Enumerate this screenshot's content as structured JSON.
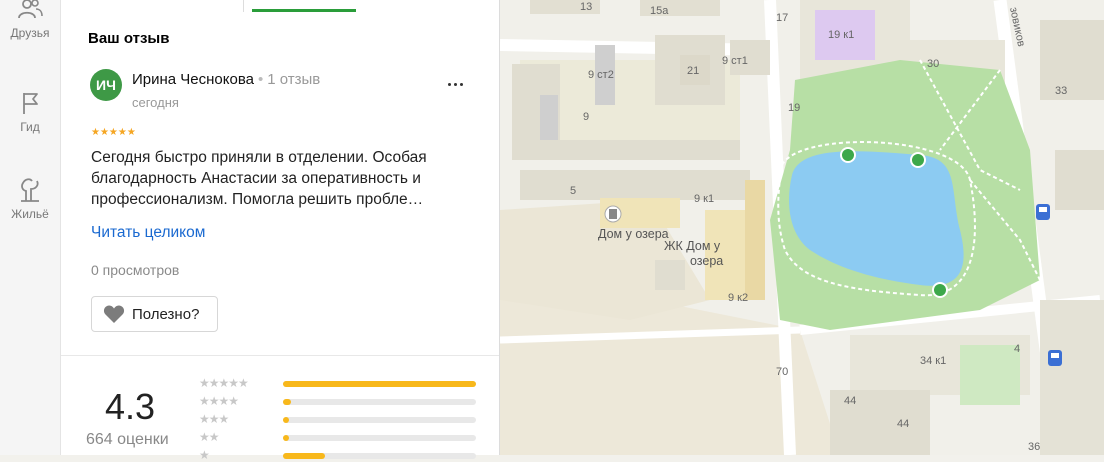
{
  "nav": {
    "items": [
      {
        "label": "Друзья",
        "icon": "friends-icon"
      },
      {
        "label": "Гид",
        "icon": "flag-icon"
      },
      {
        "label": "Жильё",
        "icon": "housing-icon"
      }
    ]
  },
  "review": {
    "section_title": "Ваш отзыв",
    "avatar_initials": "ИЧ",
    "author": "Ирина Чеснокова",
    "author_reviews": "1 отзыв",
    "date": "сегодня",
    "rating": 5,
    "stars": "★★★★★",
    "text": "Сегодня быстро приняли в отделении. Особая благодарность Анастасии за оперативность и профессионализм. Помогла решить пробле…",
    "read_more": "Читать целиком",
    "views": "0 просмотров",
    "useful_label": "Полезно?"
  },
  "summary": {
    "rating": "4.3",
    "count": "664 оценки",
    "distribution": [
      {
        "stars": "★★★★★",
        "fraction": 1.0
      },
      {
        "stars": "★★★★",
        "fraction": 0.04
      },
      {
        "stars": "★★★",
        "fraction": 0.03
      },
      {
        "stars": "★★",
        "fraction": 0.03
      },
      {
        "stars": "★",
        "fraction": 0.22
      }
    ]
  },
  "map": {
    "labels": {
      "b13": "13",
      "b15a": "15а",
      "b17": "17",
      "b19k1": "19 к1",
      "street": "зовиков",
      "b9st2": "9 ст2",
      "b21": "21",
      "b9st1": "9 ст1",
      "b30": "30",
      "b33": "33",
      "b9": "9",
      "b19": "19",
      "b5": "5",
      "b9k1": "9 к1",
      "b9k2": "9 к2",
      "b70": "70",
      "b34k1": "34 к1",
      "b4": "4",
      "b44a": "44",
      "b44b": "44",
      "b36": "36"
    },
    "pois": {
      "house_by_lake": "Дом у озера",
      "complex_line1": "ЖК Дом у",
      "complex_line2": "озера"
    }
  },
  "colors": {
    "accent_green": "#2a9d3a",
    "link": "#1a69d0",
    "star": "#f5a623",
    "bar": "#f8b81b",
    "water": "#8ccbf2",
    "park": "#b7dfa5"
  }
}
